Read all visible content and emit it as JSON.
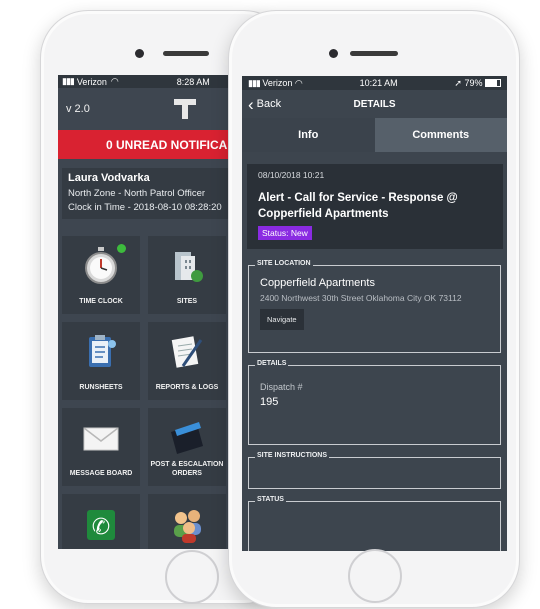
{
  "left_screen": {
    "status": {
      "carrier": "Verizon",
      "time": "8:28 AM"
    },
    "version": "v 2.0",
    "unread_banner": "0 UNREAD NOTIFICA",
    "profile": {
      "name": "Laura Vodvarka",
      "role": "North Zone - North Patrol Officer",
      "clock_in": "Clock in Time - 2018-08-10 08:28:20"
    },
    "tiles": [
      {
        "label": "TIME CLOCK",
        "icon": "stopwatch-icon"
      },
      {
        "label": "SITES",
        "icon": "buildings-icon"
      },
      {
        "label": "RUNSHEETS",
        "icon": "clipboard-icon"
      },
      {
        "label": "REPORTS & LOGS",
        "icon": "notepad-pen-icon"
      },
      {
        "label": "MESSAGE BOARD",
        "icon": "envelope-icon"
      },
      {
        "label": "POST & ESCALATION ORDERS",
        "icon": "folder-icon"
      },
      {
        "label": "",
        "icon": "phone-icon"
      },
      {
        "label": "",
        "icon": "people-icon"
      }
    ]
  },
  "right_screen": {
    "status": {
      "carrier": "Verizon",
      "time": "10:21 AM",
      "battery": "79%"
    },
    "nav": {
      "back_label": "Back",
      "title": "DETAILS"
    },
    "tabs": [
      {
        "label": "Info",
        "active": true
      },
      {
        "label": "Comments",
        "active": false
      }
    ],
    "alert": {
      "date": "08/10/2018 10:21",
      "title": "Alert - Call for Service - Response @ Copperfield Apartments",
      "status": "Status: New"
    },
    "site_location": {
      "legend": "SITE LOCATION",
      "name": "Copperfield Apartments",
      "address": "2400 Northwest 30th Street Oklahoma City OK 73112",
      "navigate_label": "Navigate"
    },
    "details": {
      "legend": "DETAILS",
      "label": "Dispatch #",
      "value": "195"
    },
    "site_instructions": {
      "legend": "SITE INSTRUCTIONS"
    },
    "status_section": {
      "legend": "STATUS"
    }
  },
  "colors": {
    "accent_red": "#d92231",
    "status_purple": "#8a2be2",
    "screen_bg": "#3e4650",
    "tile_bg": "#353c44"
  }
}
